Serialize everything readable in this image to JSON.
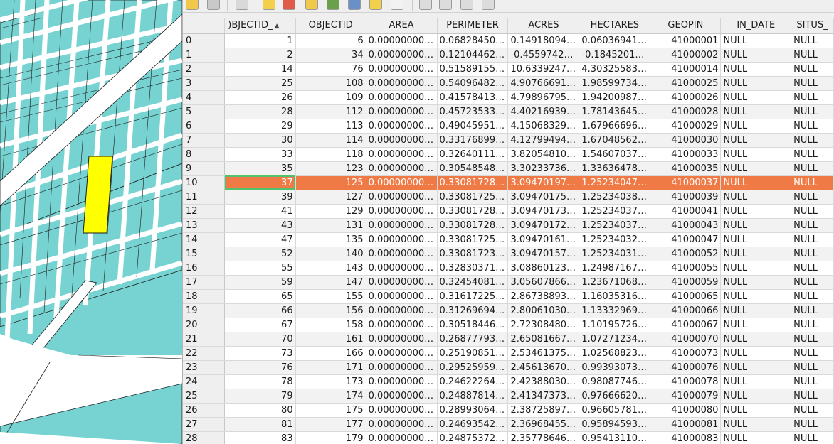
{
  "table": {
    "columns": [
      {
        "label": ")BJECTID_",
        "sort": "▲"
      },
      {
        "label": "OBJECTID"
      },
      {
        "label": "AREA"
      },
      {
        "label": "PERIMETER"
      },
      {
        "label": "ACRES"
      },
      {
        "label": "HECTARES"
      },
      {
        "label": "GEOPIN"
      },
      {
        "label": "IN_DATE"
      },
      {
        "label": "SITUS_"
      }
    ],
    "selected_row_index": 10,
    "rows": [
      [
        "0",
        "1",
        "6",
        "0.00000000…",
        "0.06828450…",
        "0.14918094…",
        "0.06036941…",
        "41000001",
        "NULL",
        "NULL"
      ],
      [
        "1",
        "2",
        "34",
        "0.00000000…",
        "0.12104462…",
        "-0.4559742…",
        "-0.1845201…",
        "41000002",
        "NULL",
        "NULL"
      ],
      [
        "2",
        "14",
        "76",
        "0.00000000…",
        "0.51589155…",
        "10.6339247…",
        "4.30325583…",
        "41000014",
        "NULL",
        "NULL"
      ],
      [
        "3",
        "25",
        "108",
        "0.00000000…",
        "0.54096482…",
        "4.90766691…",
        "1.98599734…",
        "41000025",
        "NULL",
        "NULL"
      ],
      [
        "4",
        "26",
        "109",
        "0.00000000…",
        "0.41578413…",
        "4.79896795…",
        "1.94200987…",
        "41000026",
        "NULL",
        "NULL"
      ],
      [
        "5",
        "28",
        "112",
        "0.00000000…",
        "0.45723533…",
        "4.40216939…",
        "1.78143645…",
        "41000028",
        "NULL",
        "NULL"
      ],
      [
        "6",
        "29",
        "113",
        "0.00000000…",
        "0.49045951…",
        "4.15068329…",
        "1.67966696…",
        "41000029",
        "NULL",
        "NULL"
      ],
      [
        "7",
        "30",
        "114",
        "0.00000000…",
        "0.33176899…",
        "4.12799494…",
        "1.67048562…",
        "41000030",
        "NULL",
        "NULL"
      ],
      [
        "8",
        "33",
        "118",
        "0.00000000…",
        "0.32640111…",
        "3.82054810…",
        "1.54607037…",
        "41000033",
        "NULL",
        "NULL"
      ],
      [
        "9",
        "35",
        "123",
        "0.00000000…",
        "0.30548548…",
        "3.30233736…",
        "1.33636478…",
        "41000035",
        "NULL",
        "NULL"
      ],
      [
        "10",
        "37",
        "125",
        "0.00000000…",
        "0.33081728…",
        "3.09470197…",
        "1.25234047…",
        "41000037",
        "NULL",
        "NULL"
      ],
      [
        "11",
        "39",
        "127",
        "0.00000000…",
        "0.33081725…",
        "3.09470175…",
        "1.25234038…",
        "41000039",
        "NULL",
        "NULL"
      ],
      [
        "12",
        "41",
        "129",
        "0.00000000…",
        "0.33081728…",
        "3.09470173…",
        "1.25234037…",
        "41000041",
        "NULL",
        "NULL"
      ],
      [
        "13",
        "43",
        "131",
        "0.00000000…",
        "0.33081728…",
        "3.09470172…",
        "1.25234037…",
        "41000043",
        "NULL",
        "NULL"
      ],
      [
        "14",
        "47",
        "135",
        "0.00000000…",
        "0.33081725…",
        "3.09470161…",
        "1.25234032…",
        "41000047",
        "NULL",
        "NULL"
      ],
      [
        "15",
        "52",
        "140",
        "0.00000000…",
        "0.33081723…",
        "3.09470157…",
        "1.25234031…",
        "41000052",
        "NULL",
        "NULL"
      ],
      [
        "16",
        "55",
        "143",
        "0.00000000…",
        "0.32830371…",
        "3.08860123…",
        "1.24987167…",
        "41000055",
        "NULL",
        "NULL"
      ],
      [
        "17",
        "59",
        "147",
        "0.00000000…",
        "0.32454081…",
        "3.05607866…",
        "1.23671068…",
        "41000059",
        "NULL",
        "NULL"
      ],
      [
        "18",
        "65",
        "155",
        "0.00000000…",
        "0.31617225…",
        "2.86738893…",
        "1.16035316…",
        "41000065",
        "NULL",
        "NULL"
      ],
      [
        "19",
        "66",
        "156",
        "0.00000000…",
        "0.31269694…",
        "2.80061030…",
        "1.13332969…",
        "41000066",
        "NULL",
        "NULL"
      ],
      [
        "20",
        "67",
        "158",
        "0.00000000…",
        "0.30518446…",
        "2.72308480…",
        "1.10195726…",
        "41000067",
        "NULL",
        "NULL"
      ],
      [
        "21",
        "70",
        "161",
        "0.00000000…",
        "0.26877793…",
        "2.65081667…",
        "1.07271234…",
        "41000070",
        "NULL",
        "NULL"
      ],
      [
        "22",
        "73",
        "166",
        "0.00000000…",
        "0.25190851…",
        "2.53461375…",
        "1.02568823…",
        "41000073",
        "NULL",
        "NULL"
      ],
      [
        "23",
        "76",
        "171",
        "0.00000000…",
        "0.29525959…",
        "2.45613670…",
        "0.99393073…",
        "41000076",
        "NULL",
        "NULL"
      ],
      [
        "24",
        "78",
        "173",
        "0.00000000…",
        "0.24622264…",
        "2.42388030…",
        "0.98087746…",
        "41000078",
        "NULL",
        "NULL"
      ],
      [
        "25",
        "79",
        "174",
        "0.00000000…",
        "0.24887814…",
        "2.41347373…",
        "0.97666620…",
        "41000079",
        "NULL",
        "NULL"
      ],
      [
        "26",
        "80",
        "175",
        "0.00000000…",
        "0.28993064…",
        "2.38725897…",
        "0.96605781…",
        "41000080",
        "NULL",
        "NULL"
      ],
      [
        "27",
        "81",
        "177",
        "0.00000000…",
        "0.24693542…",
        "2.36968455…",
        "0.95894593…",
        "41000081",
        "NULL",
        "NULL"
      ],
      [
        "28",
        "83",
        "179",
        "0.00000000…",
        "0.24875372…",
        "2.35778646…",
        "0.95413110…",
        "41000083",
        "NULL",
        "NULL"
      ]
    ]
  },
  "toolbar": {
    "icons": [
      "edit-pencil-icon",
      "save-edits-icon",
      "delete-selected-icon",
      "select-by-expression-icon",
      "deselect-all-icon",
      "move-selection-to-top-icon",
      "invert-selection-icon",
      "pan-map-to-selection-icon",
      "zoom-to-selection-icon",
      "copy-rows-icon",
      "paste-features-icon",
      "new-field-icon",
      "delete-field-icon",
      "field-calculator-icon"
    ]
  },
  "map": {
    "parcel_color": "#77d3d1",
    "highlight_color": "#ffff00",
    "road_color": "#ffffff",
    "outline_color": "#1c1c1c"
  },
  "colors": {
    "selected_row": "#f07a45",
    "current_cell_border": "#52c16b"
  }
}
